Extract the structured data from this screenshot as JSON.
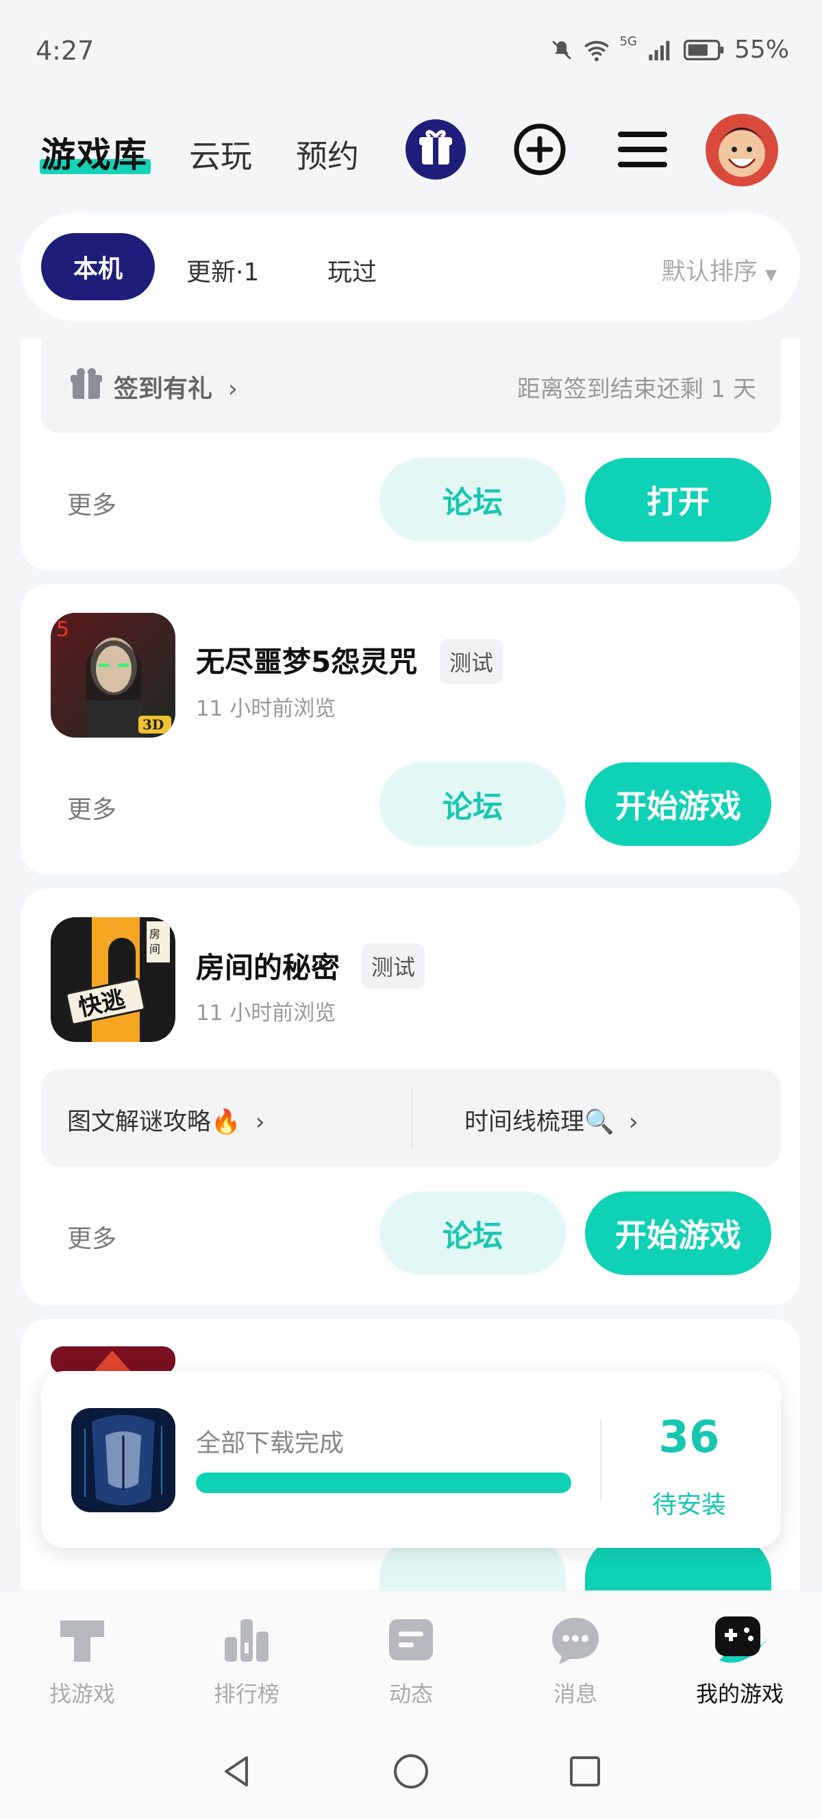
{
  "status": {
    "time": "4:27",
    "battery": "55%",
    "network": "5G"
  },
  "header": {
    "active_tab": "游戏库",
    "tabs": [
      "云玩",
      "预约"
    ]
  },
  "filters": {
    "active": "本机",
    "tabs": [
      "更新·1",
      "玩过"
    ],
    "sort": "默认排序"
  },
  "card1": {
    "banner_left": "签到有礼",
    "banner_right": "距离签到结束还剩 1 天",
    "more": "更多",
    "forum": "论坛",
    "action": "打开"
  },
  "card2": {
    "title": "无尽噩梦5怨灵咒",
    "badge": "测试",
    "sub": "11 小时前浏览",
    "more": "更多",
    "forum": "论坛",
    "action": "开始游戏"
  },
  "card3": {
    "title": "房间的秘密",
    "badge": "测试",
    "sub": "11 小时前浏览",
    "link1": "图文解谜攻略🔥",
    "link2": "时间线梳理🔍",
    "more": "更多",
    "forum": "论坛",
    "action": "开始游戏"
  },
  "download": {
    "status": "全部下载完成",
    "count": "36",
    "label": "待安装",
    "progress": 1.0
  },
  "nav": {
    "items": [
      "找游戏",
      "排行榜",
      "动态",
      "消息",
      "我的游戏"
    ]
  },
  "colors": {
    "accent": "#0fd1b6",
    "navy": "#1e1e7a"
  }
}
